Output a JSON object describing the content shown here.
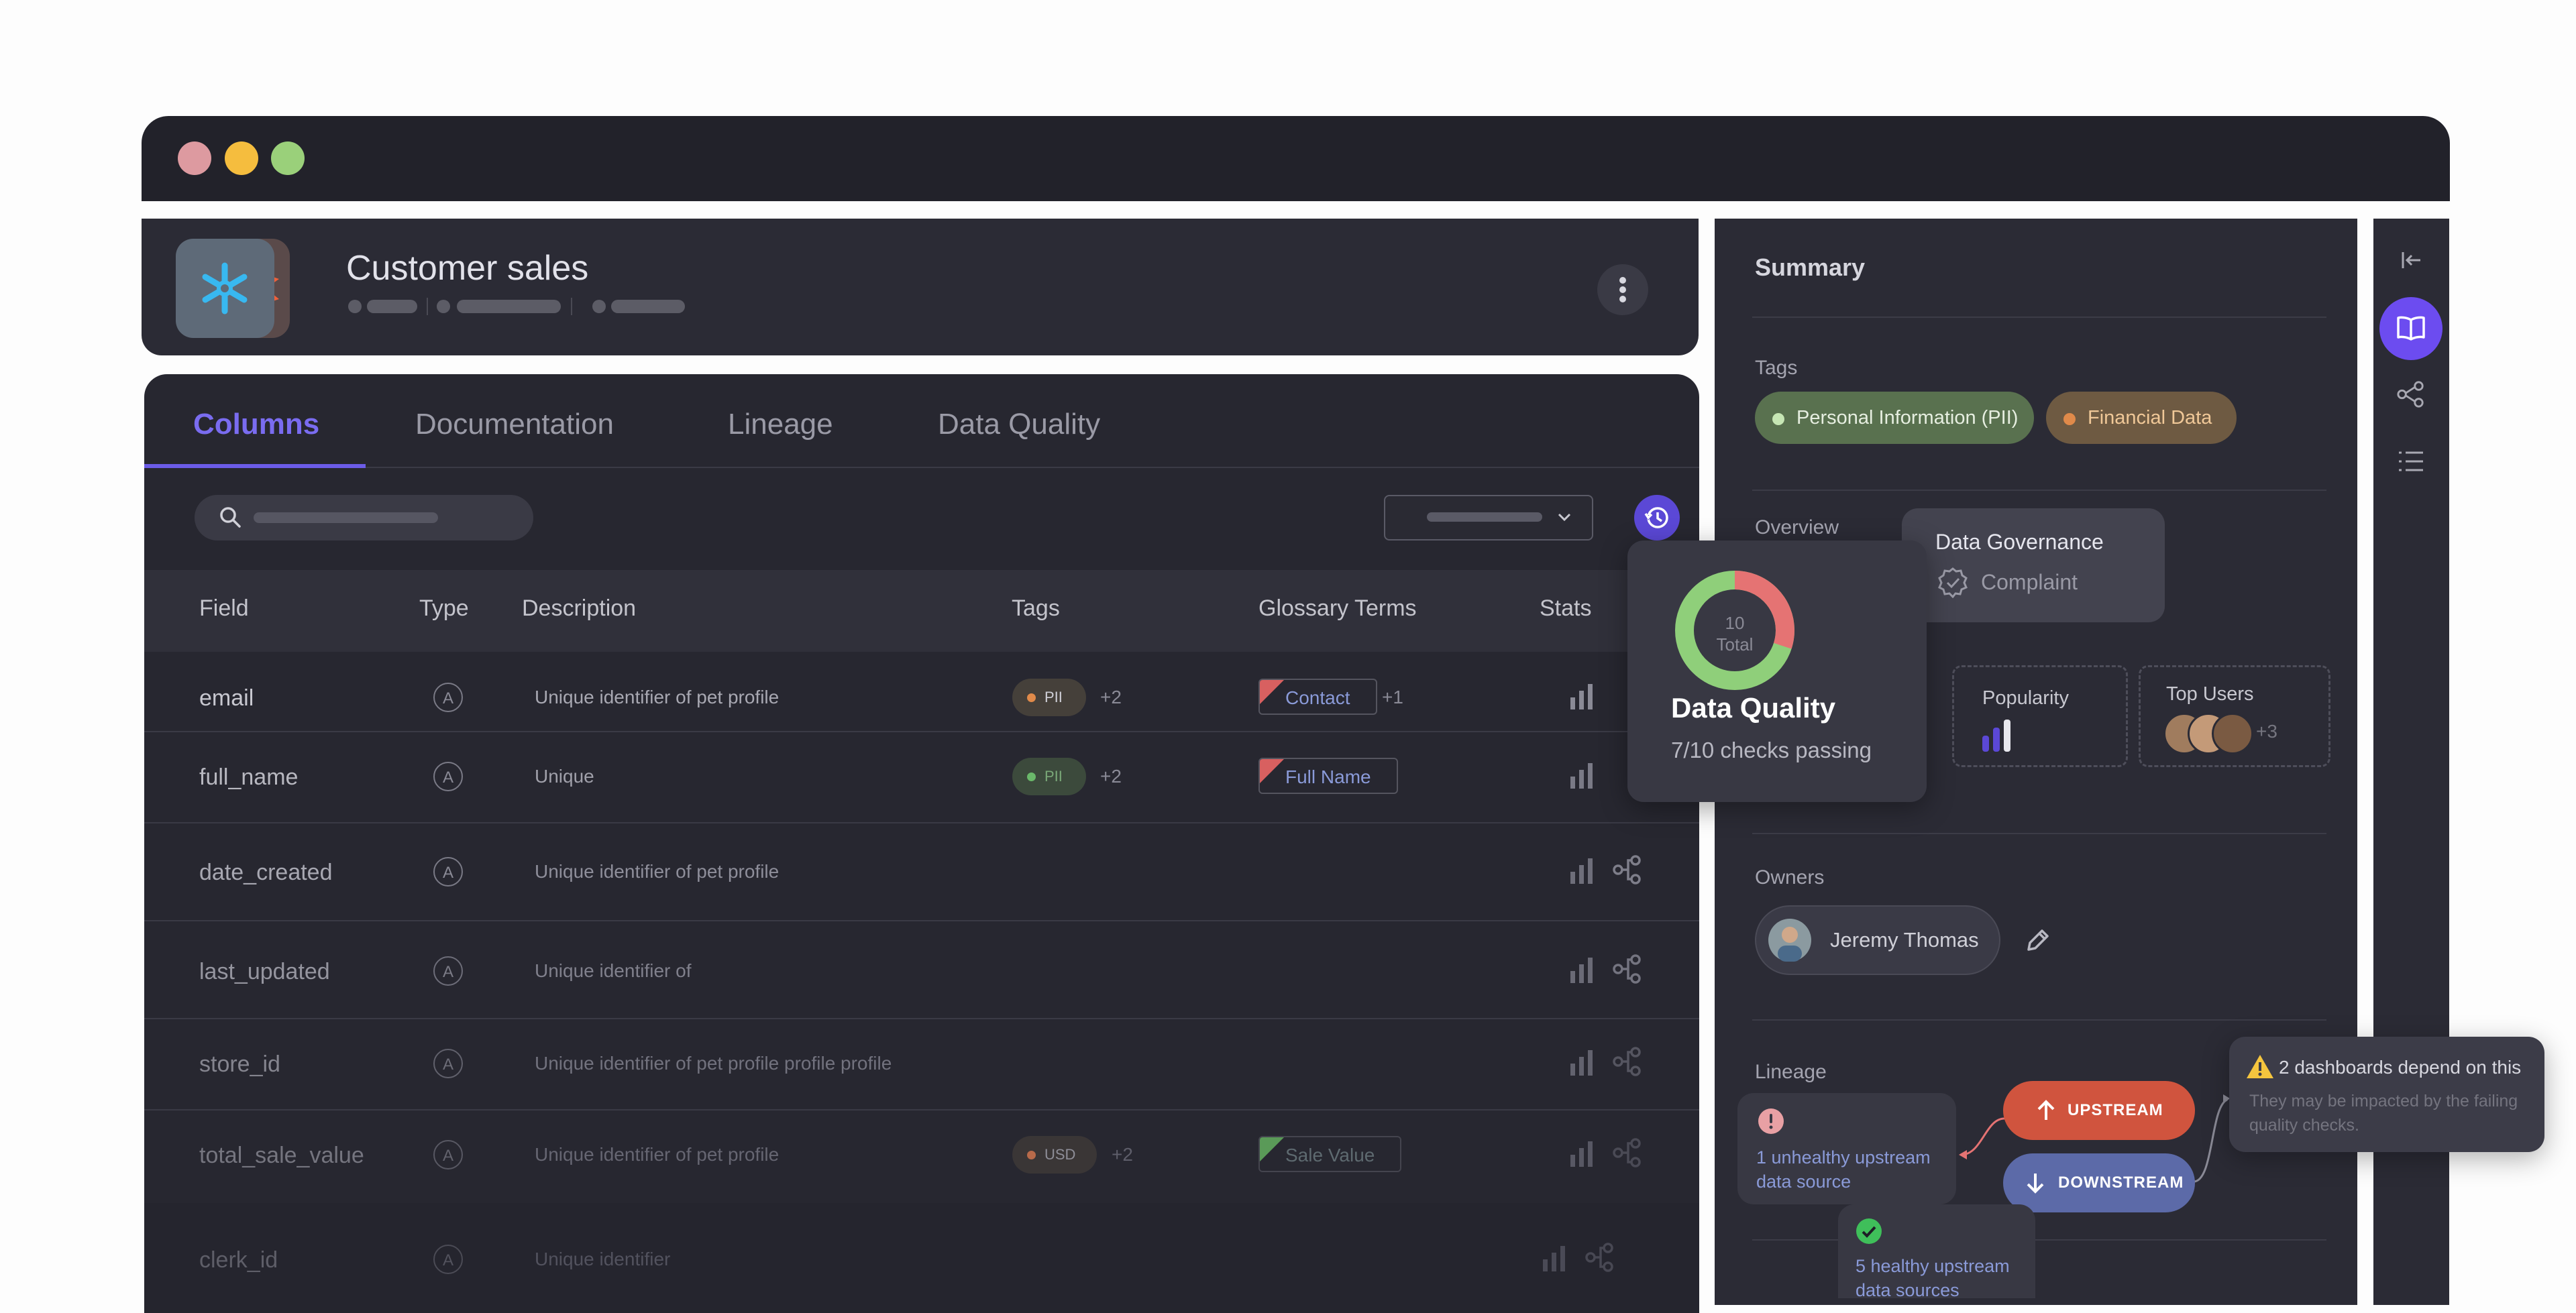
{
  "window": {
    "traffic_lights": [
      "#dd9aa0",
      "#f5bd3e",
      "#9ad07a"
    ]
  },
  "header": {
    "title": "Customer sales",
    "menu_icon": "kebab-menu-icon",
    "logo_icons": [
      "snowflake-icon",
      "dbt-icon"
    ]
  },
  "tabs": [
    {
      "label": "Columns"
    },
    {
      "label": "Documentation"
    },
    {
      "label": "Lineage"
    },
    {
      "label": "Data Quality"
    }
  ],
  "toolbar": {
    "search_icon": "search-icon",
    "history_icon": "history-icon",
    "select_icon": "chevron-down-icon"
  },
  "table": {
    "headers": [
      "Field",
      "Type",
      "Description",
      "Tags",
      "Glossary Terms",
      "Stats"
    ],
    "rows": [
      {
        "field": "email",
        "type": "A",
        "description": "Unique identifier of pet profile",
        "tag": "PII",
        "tag_more": "+2",
        "term": "Contact",
        "term_more": "+1"
      },
      {
        "field": "full_name",
        "type": "A",
        "description": "Unique",
        "tag": "PII",
        "tag_more": "+2",
        "term": "Full Name",
        "term_more": ""
      },
      {
        "field": "date_created",
        "type": "A",
        "description": "Unique identifier of pet profile",
        "tag": "",
        "tag_more": "",
        "term": "",
        "term_more": ""
      },
      {
        "field": "last_updated",
        "type": "A",
        "description": "Unique identifier of",
        "tag": "",
        "tag_more": "",
        "term": "",
        "term_more": ""
      },
      {
        "field": "store_id",
        "type": "A",
        "description": "Unique identifier of pet profile profile profile",
        "tag": "",
        "tag_more": "",
        "term": "",
        "term_more": ""
      },
      {
        "field": "total_sale_value",
        "type": "A",
        "description": "Unique identifier of pet profile",
        "tag": "USD",
        "tag_more": "+2",
        "term": "Sale Value",
        "term_more": ""
      },
      {
        "field": "clerk_id",
        "type": "A",
        "description": "Unique identifier",
        "tag": "",
        "tag_more": "",
        "term": "",
        "term_more": ""
      }
    ]
  },
  "data_quality": {
    "total_number": "10",
    "total_label": "Total",
    "title": "Data Quality",
    "subtitle": "7/10 checks passing",
    "passing": 7,
    "total": 10
  },
  "summary": {
    "title": "Summary",
    "tags_label": "Tags",
    "tags": [
      {
        "label": "Personal Information (PII)",
        "color": "#8fcf7a"
      },
      {
        "label": "Financial Data",
        "color": "#e08a4a"
      }
    ],
    "overview_label": "Overview",
    "governance": {
      "title": "Data Governance",
      "status": "Complaint"
    },
    "popularity_label": "Popularity",
    "top_users_label": "Top Users",
    "top_users_more": "+3",
    "owners_label": "Owners",
    "owner_name": "Jeremy Thomas",
    "lineage_label": "Lineage",
    "unhealthy_text": "1 unhealthy upstream data source",
    "upstream_label": "UPSTREAM",
    "downstream_label": "DOWNSTREAM",
    "healthy_text": "5 healthy upstream data sources",
    "warning_title": "2 dashboards depend on this",
    "warning_body": "They may be impacted by the failing quality checks."
  },
  "rail": {
    "icons": [
      "collapse-icon",
      "book-icon",
      "lineage-icon",
      "list-icon"
    ]
  }
}
